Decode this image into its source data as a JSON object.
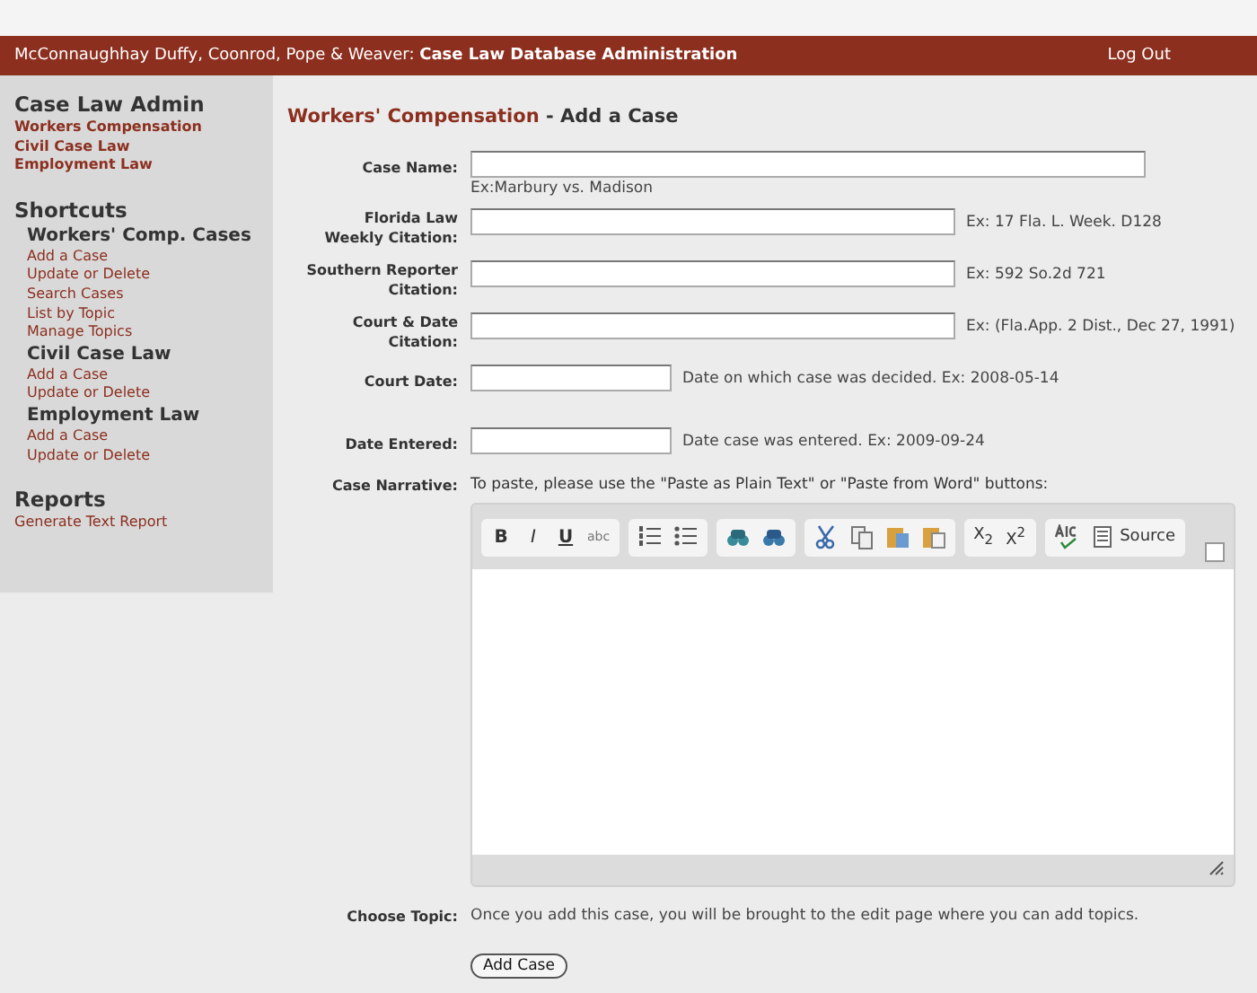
{
  "header": {
    "firm": "McConnaughhay Duffy, Coonrod, Pope & Weaver:",
    "title": "Case Law Database Administration",
    "logout": "Log Out"
  },
  "sidebar": {
    "sections": [
      {
        "title": "Case Law Admin",
        "kind": "primary",
        "links": [
          "Workers Compensation",
          "Civil Case Law",
          "Employment Law"
        ]
      },
      {
        "title": "Shortcuts",
        "kind": "plain",
        "groups": [
          {
            "title": "Workers' Comp. Cases",
            "links": [
              "Add a Case",
              "Update or Delete",
              "Search Cases",
              "List by Topic",
              "Manage Topics"
            ]
          },
          {
            "title": "Civil Case Law",
            "links": [
              "Add a Case",
              "Update or Delete"
            ]
          },
          {
            "title": "Employment Law",
            "links": [
              "Add a Case",
              "Update or Delete"
            ]
          }
        ]
      },
      {
        "title": "Reports",
        "kind": "plain",
        "links": [
          "Generate Text Report"
        ]
      }
    ]
  },
  "page_title": {
    "section": "Workers' Compensation",
    "separator": " - ",
    "action": "Add a Case"
  },
  "fields": [
    {
      "label": "Case Name:",
      "kind": "wide",
      "hint": "Ex:Marbury vs. Madison"
    },
    {
      "label": "Florida Law Weekly Citation:",
      "kind": "medium",
      "hint": "Ex: 17 Fla. L. Week. D128"
    },
    {
      "label": "Southern Reporter Citation:",
      "kind": "medium",
      "hint": "Ex: 592 So.2d 721"
    },
    {
      "label": "Court & Date Citation:",
      "kind": "medium",
      "hint": "Ex: (Fla.App. 2 Dist., Dec 27, 1991)"
    },
    {
      "label": "Court Date:",
      "kind": "short",
      "hint": "Date on which case was decided. Ex: 2008-05-14"
    },
    {
      "label": "Date Entered:",
      "kind": "short",
      "hint": "Date case was entered. Ex: 2009-09-24"
    }
  ],
  "narrative": {
    "label": "Case Narrative:",
    "note": "To paste, please use the \"Paste as Plain Text\" or \"Paste from Word\" buttons:",
    "toolbar": [
      [
        {
          "kind": "bold",
          "label": "B"
        },
        {
          "kind": "italic",
          "label": "I"
        },
        {
          "kind": "underline",
          "label": "U"
        },
        {
          "kind": "strike",
          "label": "abc"
        }
      ],
      [
        {
          "kind": "ordered-list"
        },
        {
          "kind": "bullet-list"
        }
      ],
      [
        {
          "kind": "find"
        },
        {
          "kind": "replace"
        }
      ],
      [
        {
          "kind": "cut"
        },
        {
          "kind": "copy"
        },
        {
          "kind": "paste"
        },
        {
          "kind": "paste-word"
        }
      ],
      [
        {
          "kind": "subscript",
          "label": "X$_{2}$"
        },
        {
          "kind": "superscript",
          "label": "X$^{2}$"
        }
      ],
      [
        {
          "kind": "spellcheck"
        },
        {
          "kind": "source",
          "label": "Source"
        }
      ]
    ]
  },
  "topic": {
    "label": "Choose Topic:",
    "text": "Once you add this case, you will be brought to the edit page where you can add topics."
  },
  "submit": "Add Case"
}
